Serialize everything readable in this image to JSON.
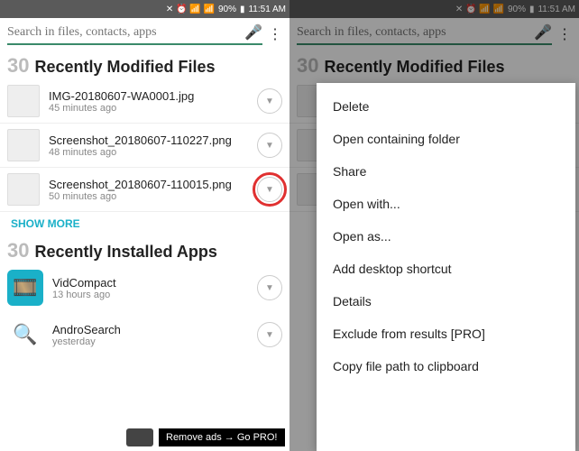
{
  "status_bar": {
    "icons": "✕ ⏰ 📶 📶",
    "battery": "90%",
    "battery_icon": "▮",
    "time": "11:51 AM"
  },
  "search": {
    "placeholder": "Search in files, contacts, apps"
  },
  "sections": {
    "files": {
      "count": "30",
      "title": "Recently Modified Files",
      "items": [
        {
          "name": "IMG-20180607-WA0001.jpg",
          "time": "45 minutes ago"
        },
        {
          "name": "Screenshot_20180607-110227.png",
          "time": "48 minutes ago"
        },
        {
          "name": "Screenshot_20180607-110015.png",
          "time": "50 minutes ago"
        }
      ],
      "show_more": "SHOW MORE"
    },
    "apps": {
      "count": "30",
      "title": "Recently Installed Apps",
      "items": [
        {
          "name": "VidCompact",
          "time": "13 hours ago"
        },
        {
          "name": "AndroSearch",
          "time": "yesterday"
        }
      ]
    }
  },
  "ad": {
    "text": "Remove ads → Go PRO!"
  },
  "context_menu": [
    "Delete",
    "Open containing folder",
    "Share",
    "Open with...",
    "Open as...",
    "Add desktop shortcut",
    "Details",
    "Exclude from results [PRO]",
    "Copy file path to clipboard"
  ]
}
